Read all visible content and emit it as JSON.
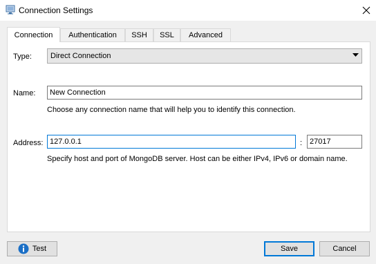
{
  "window": {
    "title": "Connection Settings",
    "icon": "monitor-icon",
    "close_icon": "close-icon"
  },
  "tabs": [
    {
      "label": "Connection",
      "active": true
    },
    {
      "label": "Authentication",
      "active": false
    },
    {
      "label": "SSH",
      "active": false
    },
    {
      "label": "SSL",
      "active": false
    },
    {
      "label": "Advanced",
      "active": false
    }
  ],
  "form": {
    "type_label": "Type:",
    "type_value": "Direct Connection",
    "name_label": "Name:",
    "name_value": "New Connection",
    "name_hint": "Choose any connection name that will help you to identify this connection.",
    "address_label": "Address:",
    "host_value": "127.0.0.1",
    "separator": ":",
    "port_value": "27017",
    "address_hint": "Specify host and port of MongoDB server. Host can be either IPv4, IPv6 or domain name."
  },
  "buttons": {
    "test_label": "Test",
    "save_label": "Save",
    "cancel_label": "Cancel"
  },
  "colors": {
    "accent": "#0078d7",
    "info_icon": "#1a6fc6"
  }
}
